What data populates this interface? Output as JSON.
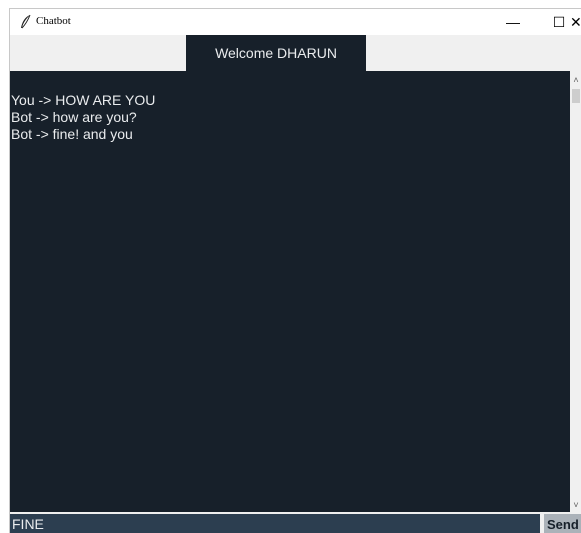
{
  "window": {
    "title": "Chatbot",
    "app_icon": "feather-icon",
    "controls": {
      "minimize": "—",
      "maximize": "☐",
      "close": "✕"
    }
  },
  "header": {
    "welcome_label": "Welcome DHARUN"
  },
  "chat": {
    "messages": [
      "You -> HOW ARE YOU",
      "Bot -> how are you?",
      "Bot -> fine! and you"
    ]
  },
  "scrollbar": {
    "up_arrow": "˄",
    "down_arrow": "˅"
  },
  "input": {
    "value": "FINE"
  },
  "send_button": {
    "label": "Send"
  },
  "colors": {
    "chat_bg": "#17202a",
    "text": "#eaecee",
    "input_bg": "#2c3e50",
    "button_bg": "#abb2b9"
  }
}
